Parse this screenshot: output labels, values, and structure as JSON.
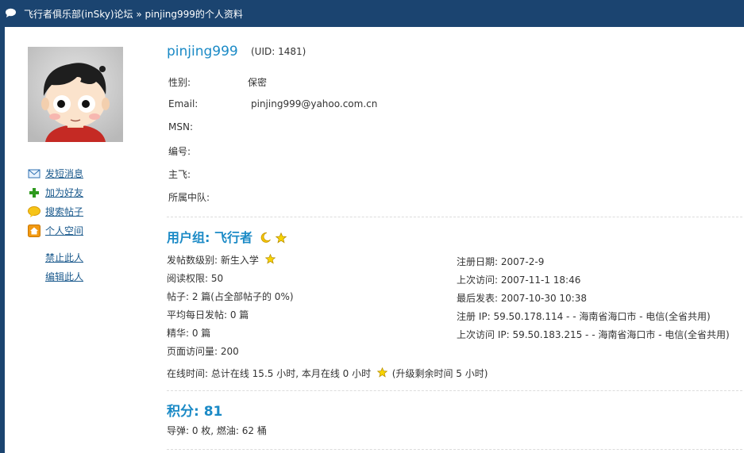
{
  "breadcrumb": {
    "forum": "飞行者俱乐部(inSky)论坛",
    "separator": "»",
    "page": "pinjing999的个人资料"
  },
  "sidebar": {
    "links": [
      {
        "label": "发短消息",
        "icon": "envelope-icon"
      },
      {
        "label": "加为好友",
        "icon": "plus-icon"
      },
      {
        "label": "搜索帖子",
        "icon": "speech-bubble-icon"
      },
      {
        "label": "个人空间",
        "icon": "home-icon"
      }
    ],
    "admin_links": [
      {
        "label": "禁止此人"
      },
      {
        "label": "编辑此人"
      }
    ]
  },
  "profile": {
    "username": "pinjing999",
    "uid": "(UID: 1481)",
    "fields": [
      {
        "label": "性别:",
        "value": "保密"
      },
      {
        "label": "Email:",
        "value": "pinjing999@yahoo.com.cn"
      },
      {
        "label": "MSN:",
        "value": ""
      },
      {
        "label": "编号:",
        "value": ""
      },
      {
        "label": "主飞:",
        "value": ""
      },
      {
        "label": "所属中队:",
        "value": ""
      }
    ]
  },
  "usergroup": {
    "title": "用户组: 飞行者"
  },
  "stats_left": {
    "post_level": "发帖数级别: 新生入学",
    "read_permission": "阅读权限: 50",
    "posts": "帖子: 2 篇(占全部帖子的 0%)",
    "daily_posts": "平均每日发帖: 0 篇",
    "digest": "精华: 0 篇",
    "page_views": "页面访问量: 200"
  },
  "stats_right": {
    "register_date": "注册日期: 2007-2-9",
    "last_visit": "上次访问: 2007-11-1 18:46",
    "last_post": "最后发表: 2007-10-30 10:38",
    "register_ip": "注册 IP: 59.50.178.114 - - 海南省海口市 - 电信(全省共用)",
    "last_visit_ip": "上次访问 IP: 59.50.183.215 - - 海南省海口市 - 电信(全省共用)"
  },
  "online_time": {
    "text": "在线时间: 总计在线 15.5 小时, 本月在线 0 小时",
    "upgrade": "(升级剩余时间 5 小时)"
  },
  "points": {
    "title": "积分: 81",
    "detail": "导弹: 0 枚, 燃油: 62 桶"
  },
  "colors": {
    "header_bg": "#1b4470",
    "accent_blue": "#1b8ac6",
    "link_blue": "#1b5a8d"
  }
}
